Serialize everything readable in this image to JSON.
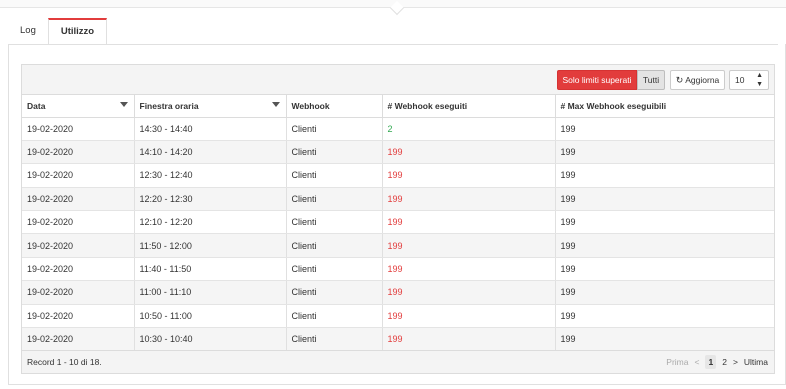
{
  "tabs": [
    {
      "label": "Log"
    },
    {
      "label": "Utilizzo"
    }
  ],
  "toolbar": {
    "limiti_label": "Solo limiti superati",
    "tutti_label": "Tutti",
    "aggiorna_label": "Aggiorna",
    "page_size": "10",
    "refresh_icon": "refresh-icon"
  },
  "columns": [
    "Data",
    "Finestra oraria",
    "Webhook",
    "# Webhook eseguiti",
    "# Max Webhook eseguibili"
  ],
  "rows": [
    {
      "data": "19-02-2020",
      "finestra": "14:30 - 14:40",
      "webhook": "Clienti",
      "eseguiti": "2",
      "max": "199"
    },
    {
      "data": "19-02-2020",
      "finestra": "14:10 - 14:20",
      "webhook": "Clienti",
      "eseguiti": "199",
      "max": "199"
    },
    {
      "data": "19-02-2020",
      "finestra": "12:30 - 12:40",
      "webhook": "Clienti",
      "eseguiti": "199",
      "max": "199"
    },
    {
      "data": "19-02-2020",
      "finestra": "12:20 - 12:30",
      "webhook": "Clienti",
      "eseguiti": "199",
      "max": "199"
    },
    {
      "data": "19-02-2020",
      "finestra": "12:10 - 12:20",
      "webhook": "Clienti",
      "eseguiti": "199",
      "max": "199"
    },
    {
      "data": "19-02-2020",
      "finestra": "11:50 - 12:00",
      "webhook": "Clienti",
      "eseguiti": "199",
      "max": "199"
    },
    {
      "data": "19-02-2020",
      "finestra": "11:40 - 11:50",
      "webhook": "Clienti",
      "eseguiti": "199",
      "max": "199"
    },
    {
      "data": "19-02-2020",
      "finestra": "11:00 - 11:10",
      "webhook": "Clienti",
      "eseguiti": "199",
      "max": "199"
    },
    {
      "data": "19-02-2020",
      "finestra": "10:50 - 11:00",
      "webhook": "Clienti",
      "eseguiti": "199",
      "max": "199"
    },
    {
      "data": "19-02-2020",
      "finestra": "10:30 - 10:40",
      "webhook": "Clienti",
      "eseguiti": "199",
      "max": "199"
    }
  ],
  "footer": {
    "record_text": "Record 1 - 10 di 18.",
    "prima": "Prima",
    "prev": "<",
    "pages": [
      "1",
      "2"
    ],
    "next": ">",
    "ultima": "Ultima"
  },
  "colors": {
    "accent": "#e23c3c",
    "ok": "#2fa84f"
  }
}
